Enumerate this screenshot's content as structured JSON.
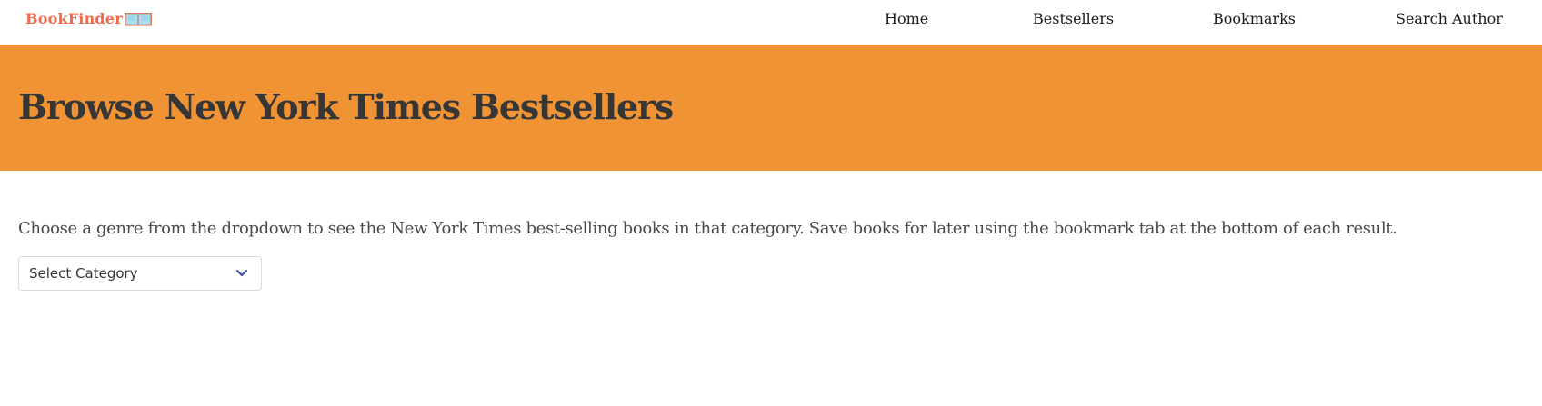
{
  "header": {
    "logo_text": "BookFinder",
    "logo_icon": "open-book-icon",
    "nav": {
      "home": "Home",
      "bestsellers": "Bestsellers",
      "bookmarks": "Bookmarks",
      "search_author": "Search Author"
    }
  },
  "hero": {
    "title": "Browse New York Times Bestsellers"
  },
  "main": {
    "intro": "Choose a genre from the dropdown to see the New York Times best-selling books in that category. Save books for later using the bookmark tab at the bottom of each result.",
    "category_select": {
      "selected": "Select Category",
      "icon": "chevron-down-icon"
    }
  },
  "colors": {
    "hero_background": "#ef9334",
    "logo": "#f26a4b",
    "chevron": "#3850a8"
  }
}
